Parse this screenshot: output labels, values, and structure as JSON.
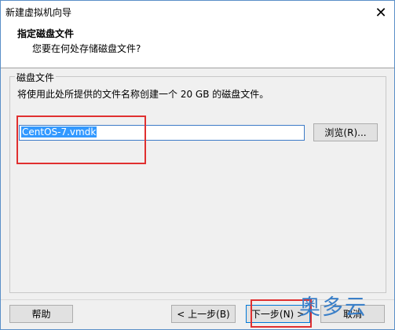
{
  "window": {
    "title": "新建虚拟机向导"
  },
  "header": {
    "title": "指定磁盘文件",
    "subtitle": "您要在何处存储磁盘文件?"
  },
  "disk_group": {
    "legend": "磁盘文件",
    "description": "将使用此处所提供的文件名称创建一个 20 GB 的磁盘文件。",
    "filename_value": "CentOS-7.vmdk",
    "browse_label": "浏览(R)..."
  },
  "footer": {
    "help_label": "帮助",
    "back_label": "< 上一步(B)",
    "next_label": "下一步(N) >",
    "cancel_label": "取消"
  },
  "watermark": {
    "text": "奥多云"
  },
  "colors": {
    "accent": "#3399ff",
    "highlight_box": "#e03030",
    "watermark": "#3a7fc8"
  }
}
